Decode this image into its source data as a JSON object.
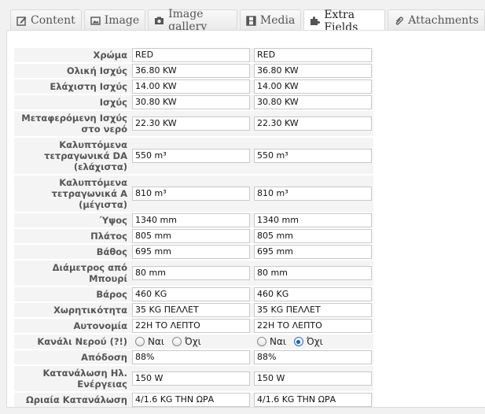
{
  "tabs": [
    {
      "label": "Content",
      "icon": "edit-icon",
      "active": false
    },
    {
      "label": "Image",
      "icon": "image-icon",
      "active": false
    },
    {
      "label": "Image gallery",
      "icon": "gallery-icon",
      "active": false
    },
    {
      "label": "Media",
      "icon": "film-icon",
      "active": false
    },
    {
      "label": "Extra Fields",
      "icon": "puzzle-icon",
      "active": true
    },
    {
      "label": "Attachments",
      "icon": "paperclip-icon",
      "active": false
    }
  ],
  "fields": [
    {
      "label": "Χρώμα",
      "values": [
        "RED",
        "RED"
      ]
    },
    {
      "label": "Ολική Ισχύς",
      "values": [
        "36.80 KW",
        "36.80 KW"
      ]
    },
    {
      "label": "Ελάχιστη Ισχύς",
      "values": [
        "14.00 KW",
        "14.00 KW"
      ]
    },
    {
      "label": "Ισχύς",
      "values": [
        "30.80 KW",
        "30.80 KW"
      ]
    },
    {
      "label": "Μεταφερόμενη Ισχύς στο νερό",
      "values": [
        "22.30 KW",
        "22.30 KW"
      ]
    },
    {
      "label": "Καλυπτόμενα τετραγωνικά DA (ελάχιστα)",
      "values": [
        "550 m³",
        "550 m³"
      ]
    },
    {
      "label": "Καλυπτόμενα τετραγωνικά A (μέγιστα)",
      "values": [
        "810 m³",
        "810 m³"
      ]
    },
    {
      "label": "Ύψος",
      "values": [
        "1340 mm",
        "1340 mm"
      ]
    },
    {
      "label": "Πλάτος",
      "values": [
        "805 mm",
        "805 mm"
      ]
    },
    {
      "label": "Βάθος",
      "values": [
        "695 mm",
        "695 mm"
      ]
    },
    {
      "label": "Διάμετρος από Μπουρί",
      "values": [
        "80 mm",
        "80 mm"
      ]
    },
    {
      "label": "Βάρος",
      "values": [
        "460 KG",
        "460 KG"
      ]
    },
    {
      "label": "Χωρητικότητα",
      "values": [
        "35 KG ΠΕΛΛΕΤ",
        "35 KG ΠΕΛΛΕΤ"
      ]
    },
    {
      "label": "Αυτονομία",
      "values": [
        "22H ΤΟ ΛΕΠΤΟ",
        "22H ΤΟ ΛΕΠΤΟ"
      ]
    },
    {
      "label": "Κανάλι Νερού (?!)",
      "radio": true,
      "options": [
        "Ναι",
        "Όχι"
      ],
      "selected": [
        null,
        "Όχι"
      ]
    },
    {
      "label": "Απόδοση",
      "values": [
        "88%",
        "88%"
      ]
    },
    {
      "label": "Κατανάλωση Ηλ. Ενέργειας",
      "values": [
        "150 W",
        "150 W"
      ]
    },
    {
      "label": "Ωριαία Κατανάλωση",
      "values": [
        "4/1.6 KG ΤΗΝ ΩΡΑ",
        "4/1.6 KG ΤΗΝ ΩΡΑ"
      ]
    }
  ]
}
